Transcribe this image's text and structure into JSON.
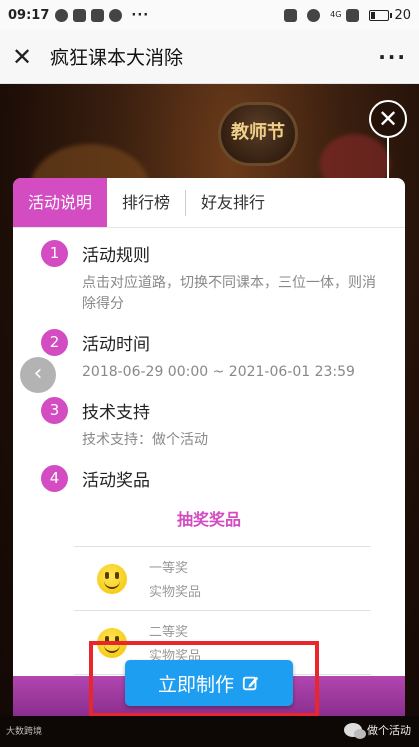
{
  "status": {
    "time": "09:17",
    "battery": "20",
    "network": "4G"
  },
  "appbar": {
    "title": "疯狂课本大消除"
  },
  "game": {
    "badge": "教师节"
  },
  "tabs": [
    {
      "label": "活动说明",
      "active": true
    },
    {
      "label": "排行榜",
      "active": false
    },
    {
      "label": "好友排行",
      "active": false
    }
  ],
  "sections": [
    {
      "num": "1",
      "title": "活动规则",
      "desc": "点击对应道路，切换不同课本，三位一体，则消除得分"
    },
    {
      "num": "2",
      "title": "活动时间",
      "desc": "2018-06-29 00:00 ~ 2021-06-01 23:59"
    },
    {
      "num": "3",
      "title": "技术支持",
      "desc": "技术支持：做个活动"
    },
    {
      "num": "4",
      "title": "活动奖品",
      "desc": ""
    }
  ],
  "prizes": {
    "header": "抽奖奖品",
    "items": [
      {
        "name": "一等奖",
        "type": "实物奖品"
      },
      {
        "name": "二等奖",
        "type": "实物奖品"
      }
    ]
  },
  "action": {
    "make_label": "立即制作"
  },
  "footer": {
    "left": "大数跨境",
    "right": "做个活动"
  }
}
